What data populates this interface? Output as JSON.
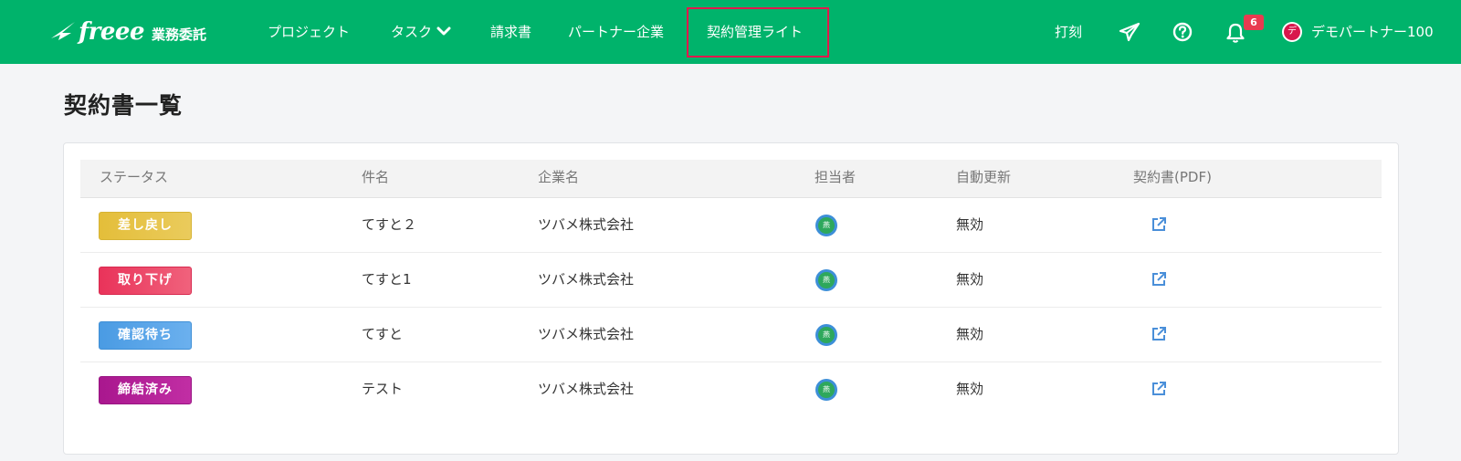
{
  "header": {
    "brand_word": "freee",
    "brand_sub": "業務委託",
    "nav": [
      {
        "label": "プロジェクト"
      },
      {
        "label": "タスク"
      },
      {
        "label": "請求書"
      },
      {
        "label": "パートナー企業"
      },
      {
        "label": "契約管理ライト"
      }
    ],
    "timecard_label": "打刻",
    "send_icon": "paper-plane-icon",
    "help_icon": "question-circle-icon",
    "notification_icon": "bell-icon",
    "notification_count": "6",
    "user_avatar_initial": "デ",
    "user_name": "デモパートナー100",
    "highlight_color": "#e2184d",
    "brand_color": "#00b36b"
  },
  "page": {
    "title": "契約書一覧"
  },
  "table": {
    "columns": [
      "ステータス",
      "件名",
      "企業名",
      "担当者",
      "自動更新",
      "契約書(PDF)"
    ],
    "rows": [
      {
        "status": "差し戻し",
        "status_color": "#e4be3a",
        "subject": "てすと２",
        "company": "ツバメ株式会社",
        "owner_avatar": "燕",
        "auto_renew": "無効",
        "pdf_icon": "external-link-icon"
      },
      {
        "status": "取り下げ",
        "status_color": "#e9335a",
        "subject": "てすと1",
        "company": "ツバメ株式会社",
        "owner_avatar": "燕",
        "auto_renew": "無効",
        "pdf_icon": "external-link-icon"
      },
      {
        "status": "確認待ち",
        "status_color": "#4a9be3",
        "subject": "てすと",
        "company": "ツバメ株式会社",
        "owner_avatar": "燕",
        "auto_renew": "無効",
        "pdf_icon": "external-link-icon"
      },
      {
        "status": "締結済み",
        "status_color": "#a9178e",
        "subject": "テスト",
        "company": "ツバメ株式会社",
        "owner_avatar": "燕",
        "auto_renew": "無効",
        "pdf_icon": "external-link-icon"
      }
    ]
  }
}
